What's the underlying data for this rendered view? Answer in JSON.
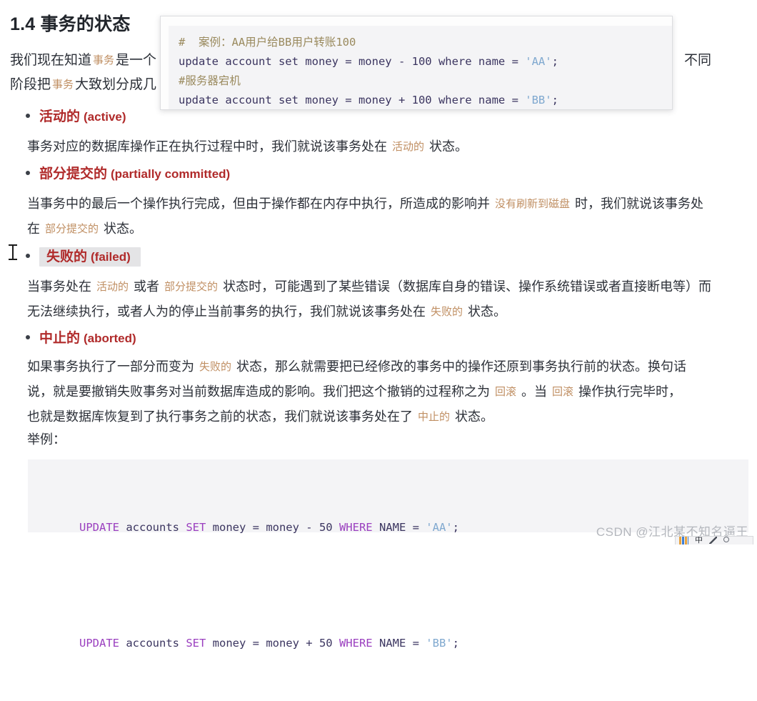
{
  "heading": {
    "number": "1.4",
    "title": "事务的状态"
  },
  "intro": {
    "line1_a": "我们现在知道",
    "line1_em": "事务",
    "line1_b": "是一个",
    "line1_tail": "不同",
    "line2_a": "阶段把",
    "line2_em": "事务",
    "line2_b": "大致划分成几"
  },
  "popup_code": {
    "line1": "#  案例：AA用户给BB用户转账100",
    "line2_code": "update account set money = money - 100 where name = ",
    "line2_str": "'AA'",
    "line2_end": ";",
    "line3": "#服务器宕机",
    "line4_code": "update account set money = money + 100 where name = ",
    "line4_str": "'BB'",
    "line4_end": ";"
  },
  "states": [
    {
      "cn": "活动的",
      "en": "(active)",
      "selected": false,
      "body": [
        {
          "t": "事务对应的数据库操作正在执行过程中时，我们就说该事务处在 ",
          "em": false
        },
        {
          "t": "活动的",
          "em": true
        },
        {
          "t": " 状态。",
          "em": false
        }
      ]
    },
    {
      "cn": "部分提交的",
      "en": "(partially committed)",
      "selected": false,
      "body": [
        {
          "t": "当事务中的最后一个操作执行完成，但由于操作都在内存中执行，所造成的影响并 ",
          "em": false
        },
        {
          "t": "没有刷新到磁盘",
          "em": true
        },
        {
          "t": " 时，我们就说该事务处在 ",
          "em": false
        },
        {
          "t": "部分提交的",
          "em": true
        },
        {
          "t": " 状态。",
          "em": false
        }
      ]
    },
    {
      "cn": "失败的",
      "en": "(failed)",
      "selected": true,
      "body": [
        {
          "t": "当事务处在 ",
          "em": false
        },
        {
          "t": "活动的",
          "em": true
        },
        {
          "t": " 或者 ",
          "em": false
        },
        {
          "t": "部分提交的",
          "em": true
        },
        {
          "t": " 状态时，可能遇到了某些错误（数据库自身的错误、操作系统错误或者直接断电等）而无法继续执行，或者人为的停止当前事务的执行，我们就说该事务处在 ",
          "em": false
        },
        {
          "t": "失败的",
          "em": true
        },
        {
          "t": " 状态。",
          "em": false
        }
      ]
    },
    {
      "cn": "中止的",
      "en": "(aborted)",
      "selected": false,
      "body": [
        {
          "t": "如果事务执行了一部分而变为 ",
          "em": false
        },
        {
          "t": "失败的",
          "em": true
        },
        {
          "t": " 状态，那么就需要把已经修改的事务中的操作还原到事务执行前的状态。换句话说，就是要撤销失败事务对当前数据库造成的影响。我们把这个撤销的过程称之为 ",
          "em": false
        },
        {
          "t": "回滚",
          "em": true
        },
        {
          "t": " 。当 ",
          "em": false
        },
        {
          "t": "回滚",
          "em": true
        },
        {
          "t": " 操作执行完毕时，也就是数据库恢复到了执行事务之前的状态，我们就说该事务处在了 ",
          "em": false
        },
        {
          "t": "中止的",
          "em": true
        },
        {
          "t": " 状态。",
          "em": false
        }
      ]
    }
  ],
  "example_label": "举例：",
  "example_code": {
    "line1": [
      {
        "t": "UPDATE",
        "c": "kw"
      },
      {
        "t": " accounts ",
        "c": ""
      },
      {
        "t": "SET",
        "c": "kw"
      },
      {
        "t": " money = money - 50 ",
        "c": ""
      },
      {
        "t": "WHERE",
        "c": "kw"
      },
      {
        "t": " NAME = ",
        "c": ""
      },
      {
        "t": "'AA'",
        "c": "cbstr"
      },
      {
        "t": ";",
        "c": ""
      }
    ],
    "line2": [
      {
        "t": "UPDATE",
        "c": "kw"
      },
      {
        "t": " accounts ",
        "c": ""
      },
      {
        "t": "SET",
        "c": "kw"
      },
      {
        "t": " money = money + 50 ",
        "c": ""
      },
      {
        "t": "WHERE",
        "c": "kw"
      },
      {
        "t": " NAME = ",
        "c": ""
      },
      {
        "t": "'BB'",
        "c": "cbstr"
      },
      {
        "t": ";",
        "c": ""
      }
    ]
  },
  "watermark": "CSDN @江北某不知名逼王",
  "ime": {
    "lang": "中"
  },
  "colors": {
    "heading": "#21252b",
    "bullet_red": "#b02a2a",
    "emphasis_tan": "#c08f63",
    "code_purple": "#3b3560",
    "keyword_purple": "#9a3fbf",
    "string_blue": "#7fa8cf",
    "code_bg": "#f4f4f6",
    "selection_gray": "#e4e4e6",
    "watermark_gray": "#b4b7bd"
  }
}
